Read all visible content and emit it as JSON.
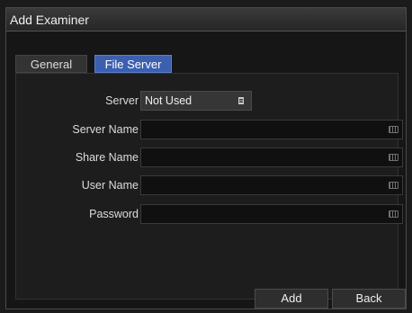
{
  "window": {
    "title": "Add Examiner"
  },
  "tabs": [
    {
      "label": "General"
    },
    {
      "label": "File Server"
    }
  ],
  "form": {
    "server": {
      "label": "Server",
      "value": "Not Used"
    },
    "server_name": {
      "label": "Server Name",
      "value": ""
    },
    "share_name": {
      "label": "Share Name",
      "value": ""
    },
    "user_name": {
      "label": "User Name",
      "value": ""
    },
    "password": {
      "label": "Password",
      "value": ""
    }
  },
  "buttons": {
    "add": "Add",
    "back": "Back"
  },
  "colors": {
    "active_tab": "#3d5fb0",
    "background": "#1d1d1d"
  },
  "icons": {
    "field_icon": "keyboard-icon",
    "select_icon": "list-icon"
  }
}
